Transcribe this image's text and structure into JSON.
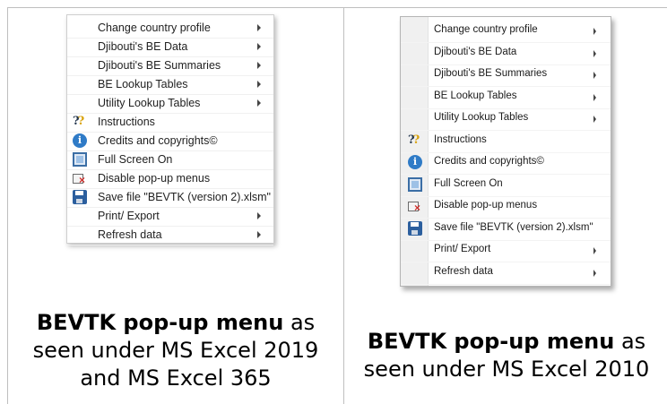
{
  "menu_2019": {
    "items": [
      {
        "label": "Change country profile",
        "submenu": true,
        "icon": null
      },
      {
        "label": "Djibouti's BE Data",
        "submenu": true,
        "icon": null
      },
      {
        "label": "Djibouti's BE Summaries",
        "submenu": true,
        "icon": null
      },
      {
        "label": "BE Lookup Tables",
        "submenu": true,
        "icon": null
      },
      {
        "label": "Utility Lookup Tables",
        "submenu": true,
        "icon": null
      },
      {
        "label": "Instructions",
        "submenu": false,
        "icon": "help-icon"
      },
      {
        "label": "Credits and copyrights©",
        "submenu": false,
        "icon": "info-icon"
      },
      {
        "label": "Full Screen On",
        "submenu": false,
        "icon": "fullscreen-icon"
      },
      {
        "label": "Disable pop-up menus",
        "submenu": false,
        "icon": "disable-menu-icon"
      },
      {
        "label": "Save file \"BEVTK (version 2).xlsm\"",
        "submenu": false,
        "icon": "save-icon"
      },
      {
        "label": "Print/ Export",
        "submenu": true,
        "icon": null
      },
      {
        "label": "Refresh data",
        "submenu": true,
        "icon": null
      }
    ]
  },
  "menu_2010": {
    "items": [
      {
        "label": "Change country profile",
        "submenu": true,
        "icon": null
      },
      {
        "label": "Djibouti's BE Data",
        "submenu": true,
        "icon": null
      },
      {
        "label": "Djibouti's BE Summaries",
        "submenu": true,
        "icon": null
      },
      {
        "label": "BE Lookup Tables",
        "submenu": true,
        "icon": null
      },
      {
        "label": "Utility Lookup Tables",
        "submenu": true,
        "icon": null
      },
      {
        "label": "Instructions",
        "submenu": false,
        "icon": "help-icon"
      },
      {
        "label": "Credits and copyrights©",
        "submenu": false,
        "icon": "info-icon"
      },
      {
        "label": "Full Screen On",
        "submenu": false,
        "icon": "fullscreen-icon"
      },
      {
        "label": "Disable pop-up menus",
        "submenu": false,
        "icon": "disable-menu-icon"
      },
      {
        "label": "Save file \"BEVTK (version 2).xlsm\"",
        "submenu": false,
        "icon": "save-icon"
      },
      {
        "label": "Print/ Export",
        "submenu": true,
        "icon": null
      },
      {
        "label": "Refresh data",
        "submenu": true,
        "icon": null
      }
    ]
  },
  "captions": {
    "left_bold": "BEVTK pop-up menu",
    "left_rest": " as seen under MS Excel 2019 and MS Excel 365",
    "right_bold": "BEVTK pop-up menu",
    "right_rest": " as seen under MS Excel 2010"
  },
  "colors": {
    "info_icon": "#2f7bc7",
    "save_icon": "#2c5f9e",
    "disable_x": "#d0312d",
    "border": "#bfbfbf"
  }
}
